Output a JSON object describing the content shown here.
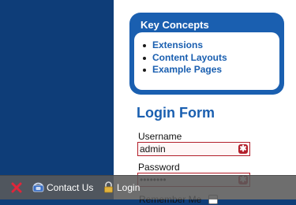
{
  "key_concepts": {
    "title": "Key Concepts",
    "links": [
      "Extensions",
      "Content Layouts",
      "Example Pages"
    ]
  },
  "login_form": {
    "title": "Login Form",
    "username_label": "Username",
    "username_value": "admin",
    "password_label": "Password",
    "password_value": "password",
    "remember_label": "Remember Me"
  },
  "toolbar": {
    "contact_label": "Contact Us",
    "login_label": "Login"
  },
  "icons": {
    "close": "close-icon",
    "contact": "phone-icon",
    "login": "lock-icon",
    "required": "asterisk-icon"
  },
  "colors": {
    "brand_blue": "#1a5fb0",
    "dark_navy": "#0e3d78",
    "error_red": "#b21f2a"
  }
}
